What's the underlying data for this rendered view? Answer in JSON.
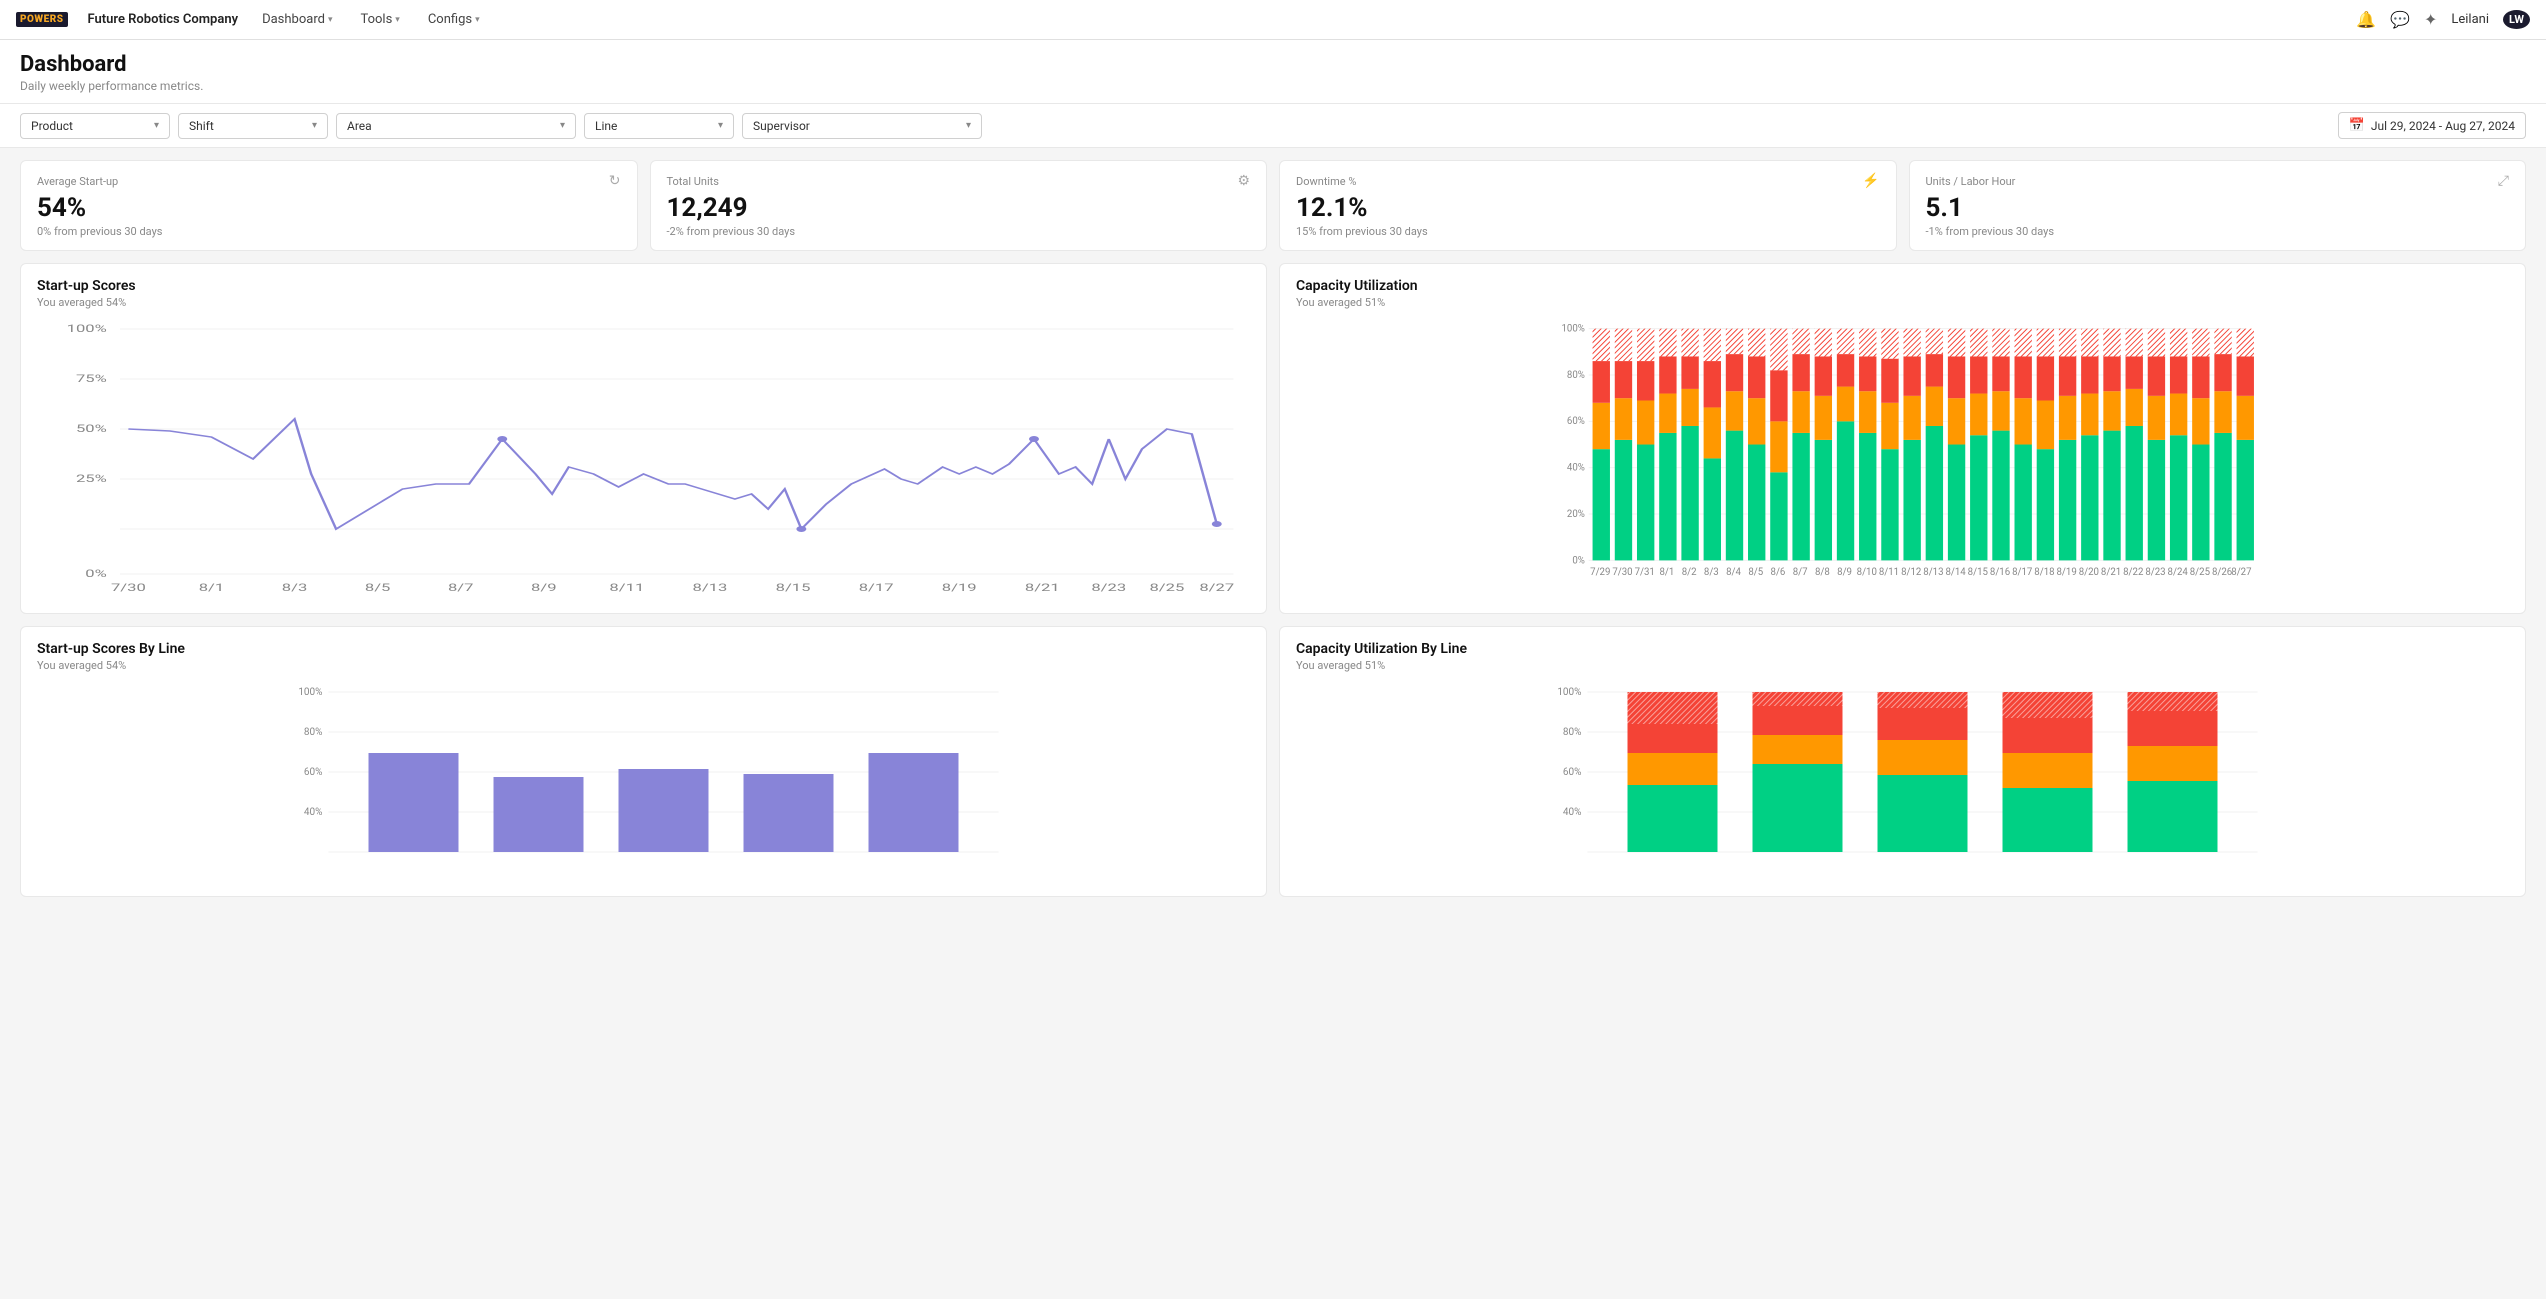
{
  "nav": {
    "logo": "POWERS",
    "company": "Future Robotics Company",
    "items": [
      "Dashboard",
      "Tools",
      "Configs"
    ],
    "icons": [
      "bell",
      "chat",
      "gear"
    ],
    "user": "Leilani",
    "avatar": "LW"
  },
  "page": {
    "title": "Dashboard",
    "subtitle": "Daily weekly performance metrics."
  },
  "filters": {
    "product": "Product",
    "shift": "Shift",
    "area": "Area",
    "line": "Line",
    "supervisor": "Supervisor",
    "date_range": "Jul 29, 2024 - Aug 27, 2024"
  },
  "kpis": [
    {
      "label": "Average Start-up",
      "value": "54%",
      "change": "0% from previous 30 days",
      "icon": "refresh"
    },
    {
      "label": "Total Units",
      "value": "12,249",
      "change": "-2% from previous 30 days",
      "icon": "settings"
    },
    {
      "label": "Downtime %",
      "value": "12.1%",
      "change": "15% from previous 30 days",
      "icon": "lightning"
    },
    {
      "label": "Units / Labor Hour",
      "value": "5.1",
      "change": "-1% from previous 30 days",
      "icon": "resize"
    }
  ],
  "startup_scores_chart": {
    "title": "Start-up Scores",
    "subtitle": "You averaged 54%",
    "y_labels": [
      "100%",
      "75%",
      "50%",
      "25%",
      "0%"
    ],
    "x_labels": [
      "7/30",
      "8/1",
      "8/3",
      "8/5",
      "8/7",
      "8/9",
      "8/11",
      "8/13",
      "8/15",
      "8/17",
      "8/19",
      "8/21",
      "8/23",
      "8/25",
      "8/27"
    ]
  },
  "capacity_util_chart": {
    "title": "Capacity Utilization",
    "subtitle": "You averaged 51%",
    "y_labels": [
      "100%",
      "80%",
      "60%",
      "40%",
      "20%",
      "0%"
    ],
    "x_labels": [
      "7/29",
      "7/30",
      "7/31",
      "8/1",
      "8/2",
      "8/3",
      "8/4",
      "8/5",
      "8/6",
      "8/7",
      "8/8",
      "8/9",
      "8/10",
      "8/11",
      "8/12",
      "8/13",
      "8/14",
      "8/15",
      "8/16",
      "8/17",
      "8/18",
      "8/19",
      "8/20",
      "8/21",
      "8/22",
      "8/23",
      "8/24",
      "8/25",
      "8/26",
      "8/27"
    ]
  },
  "startup_by_line_chart": {
    "title": "Start-up Scores By Line",
    "subtitle": "You averaged 54%",
    "y_labels": [
      "100%",
      "80%",
      "60%",
      "40%"
    ],
    "bars": [
      62,
      47,
      52,
      49,
      62
    ]
  },
  "capacity_by_line_chart": {
    "title": "Capacity Utilization By Line",
    "subtitle": "You averaged 51%",
    "y_labels": [
      "100%",
      "80%",
      "60%",
      "40%"
    ]
  }
}
